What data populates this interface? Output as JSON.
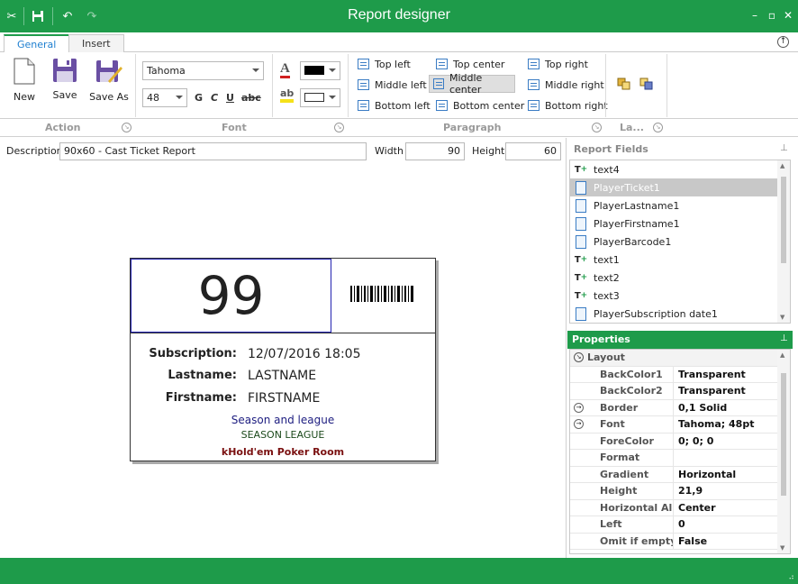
{
  "window": {
    "title": "Report designer"
  },
  "tabs": [
    {
      "label": "General"
    },
    {
      "label": "Insert"
    }
  ],
  "ribbon": {
    "action": {
      "new_label": "New",
      "save_label": "Save",
      "save_as_label": "Save As",
      "group_label": "Action"
    },
    "font": {
      "family": "Tahoma",
      "size": "48",
      "bold": "G",
      "italic": "C",
      "underline": "U",
      "strike": "abc",
      "group_label": "Font"
    },
    "paragraph": {
      "group_label": "Paragraph",
      "buttons": [
        {
          "label": "Top left"
        },
        {
          "label": "Top center"
        },
        {
          "label": "Top right"
        },
        {
          "label": "Middle left"
        },
        {
          "label": "Middle center"
        },
        {
          "label": "Middle right"
        },
        {
          "label": "Bottom left"
        },
        {
          "label": "Bottom center"
        },
        {
          "label": "Bottom right"
        }
      ]
    },
    "layout": {
      "group_label": "La..."
    }
  },
  "description": {
    "label": "Description",
    "value": "90x60 - Cast Ticket Report",
    "width_label": "Width",
    "width_value": "90",
    "height_label": "Height",
    "height_value": "60"
  },
  "ticket": {
    "number": "99",
    "rows": [
      {
        "label": "Subscription:",
        "value": "12/07/2016 18:05"
      },
      {
        "label": "Lastname:",
        "value": "LASTNAME"
      },
      {
        "label": "Firstname:",
        "value": "FIRSTNAME"
      }
    ],
    "season_label": "Season and league",
    "season_value": "SEASON LEAGUE",
    "room": "kHold'em Poker Room"
  },
  "report_fields": {
    "title": "Report Fields",
    "items": [
      {
        "label": "text4",
        "type": "text"
      },
      {
        "label": "PlayerTicket1",
        "type": "field"
      },
      {
        "label": "PlayerLastname1",
        "type": "field"
      },
      {
        "label": "PlayerFirstname1",
        "type": "field"
      },
      {
        "label": "PlayerBarcode1",
        "type": "field"
      },
      {
        "label": "text1",
        "type": "text"
      },
      {
        "label": "text2",
        "type": "text"
      },
      {
        "label": "text3",
        "type": "text"
      },
      {
        "label": "PlayerSubscription date1",
        "type": "field"
      }
    ]
  },
  "properties": {
    "title": "Properties",
    "category": "Layout",
    "rows": [
      {
        "name": "BackColor1",
        "value": "Transparent",
        "expand": false
      },
      {
        "name": "BackColor2",
        "value": "Transparent",
        "expand": false
      },
      {
        "name": "Border",
        "value": "0,1 Solid",
        "expand": true
      },
      {
        "name": "Font",
        "value": "Tahoma; 48pt",
        "expand": true
      },
      {
        "name": "ForeColor",
        "value": "0; 0; 0",
        "expand": false
      },
      {
        "name": "Format",
        "value": "",
        "expand": false
      },
      {
        "name": "Gradient",
        "value": "Horizontal",
        "expand": false
      },
      {
        "name": "Height",
        "value": "21,9",
        "expand": false
      },
      {
        "name": "Horizontal Alig",
        "value": "Center",
        "expand": false
      },
      {
        "name": "Left",
        "value": "0",
        "expand": false
      },
      {
        "name": "Omit if empty",
        "value": "False",
        "expand": false
      }
    ]
  },
  "colors": {
    "accent": "#1e9b4a",
    "selection": "#c8c8c8",
    "font_color": "#000000",
    "highlight_color": "#ffffff"
  }
}
